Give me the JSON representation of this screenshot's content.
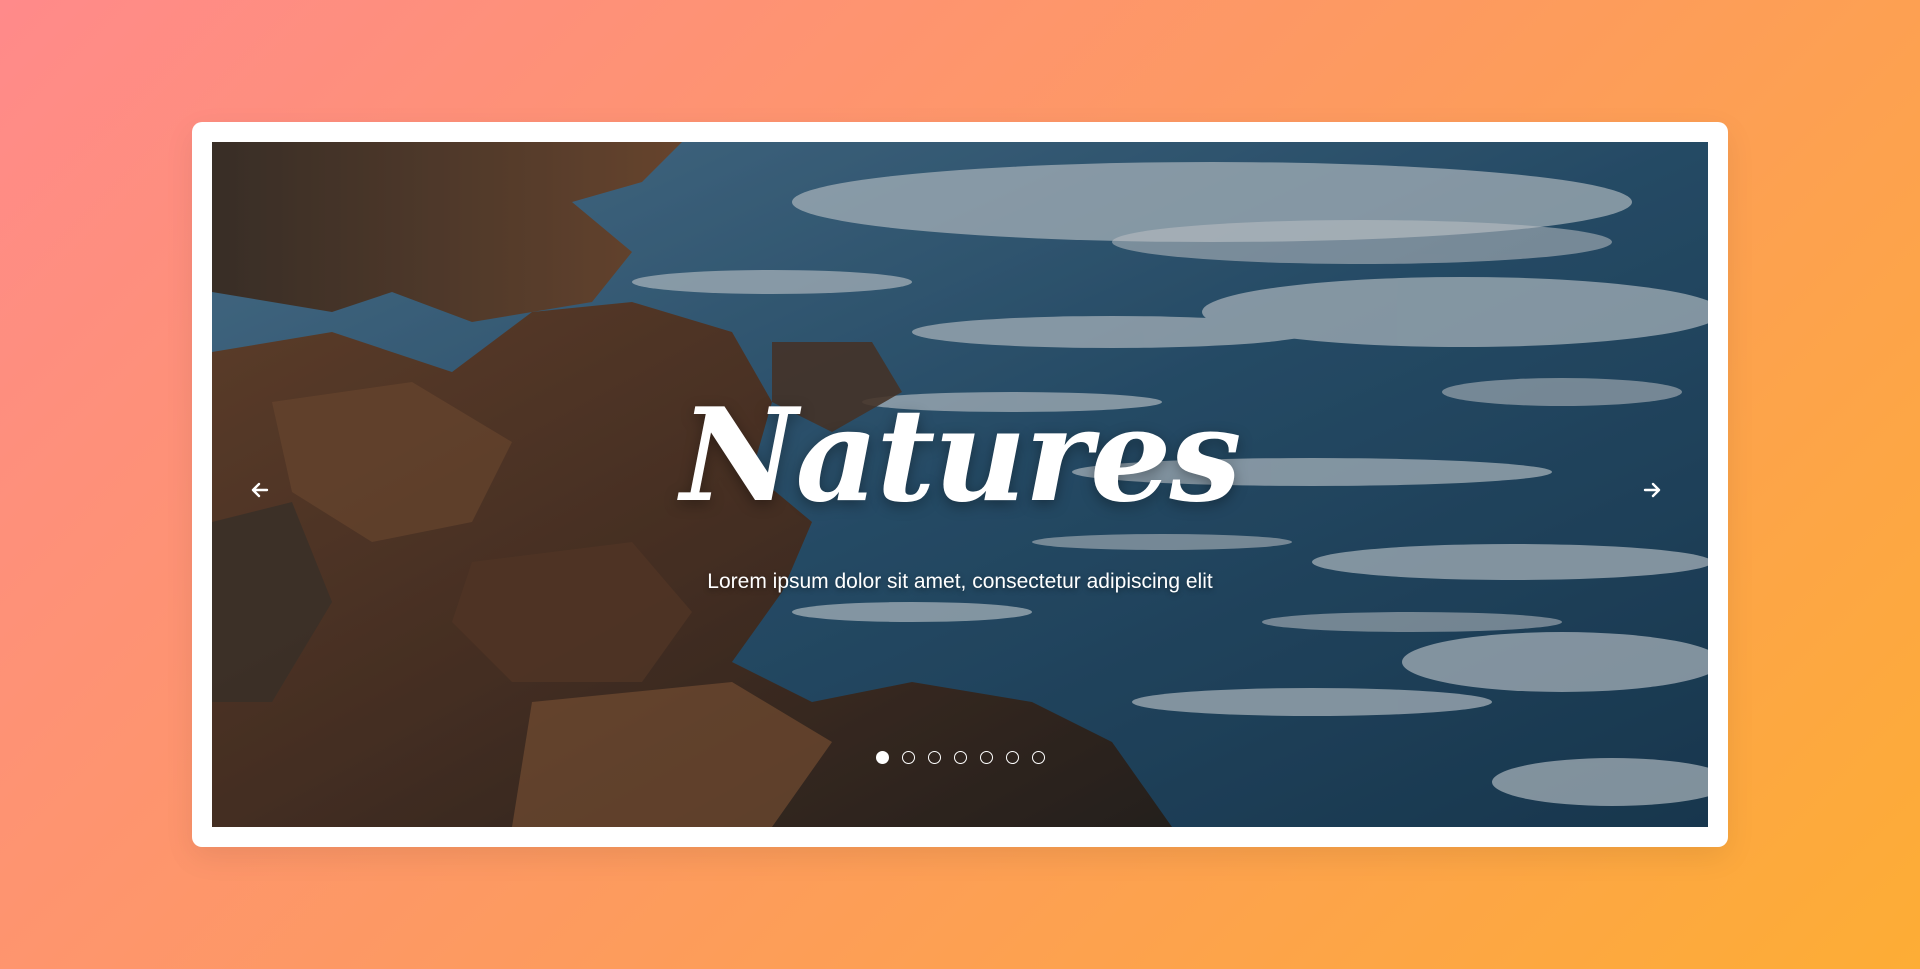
{
  "slider": {
    "title": "Natures",
    "subtitle": "Lorem ipsum dolor sit amet, consectetur adipiscing elit",
    "prev_icon": "arrow-left-icon",
    "next_icon": "arrow-right-icon",
    "slide_count": 7,
    "active_index": 0
  },
  "colors": {
    "gradient_start": "#ff8a8a",
    "gradient_end": "#fdad35",
    "frame": "#ffffff",
    "caption_text": "#ffffff"
  }
}
